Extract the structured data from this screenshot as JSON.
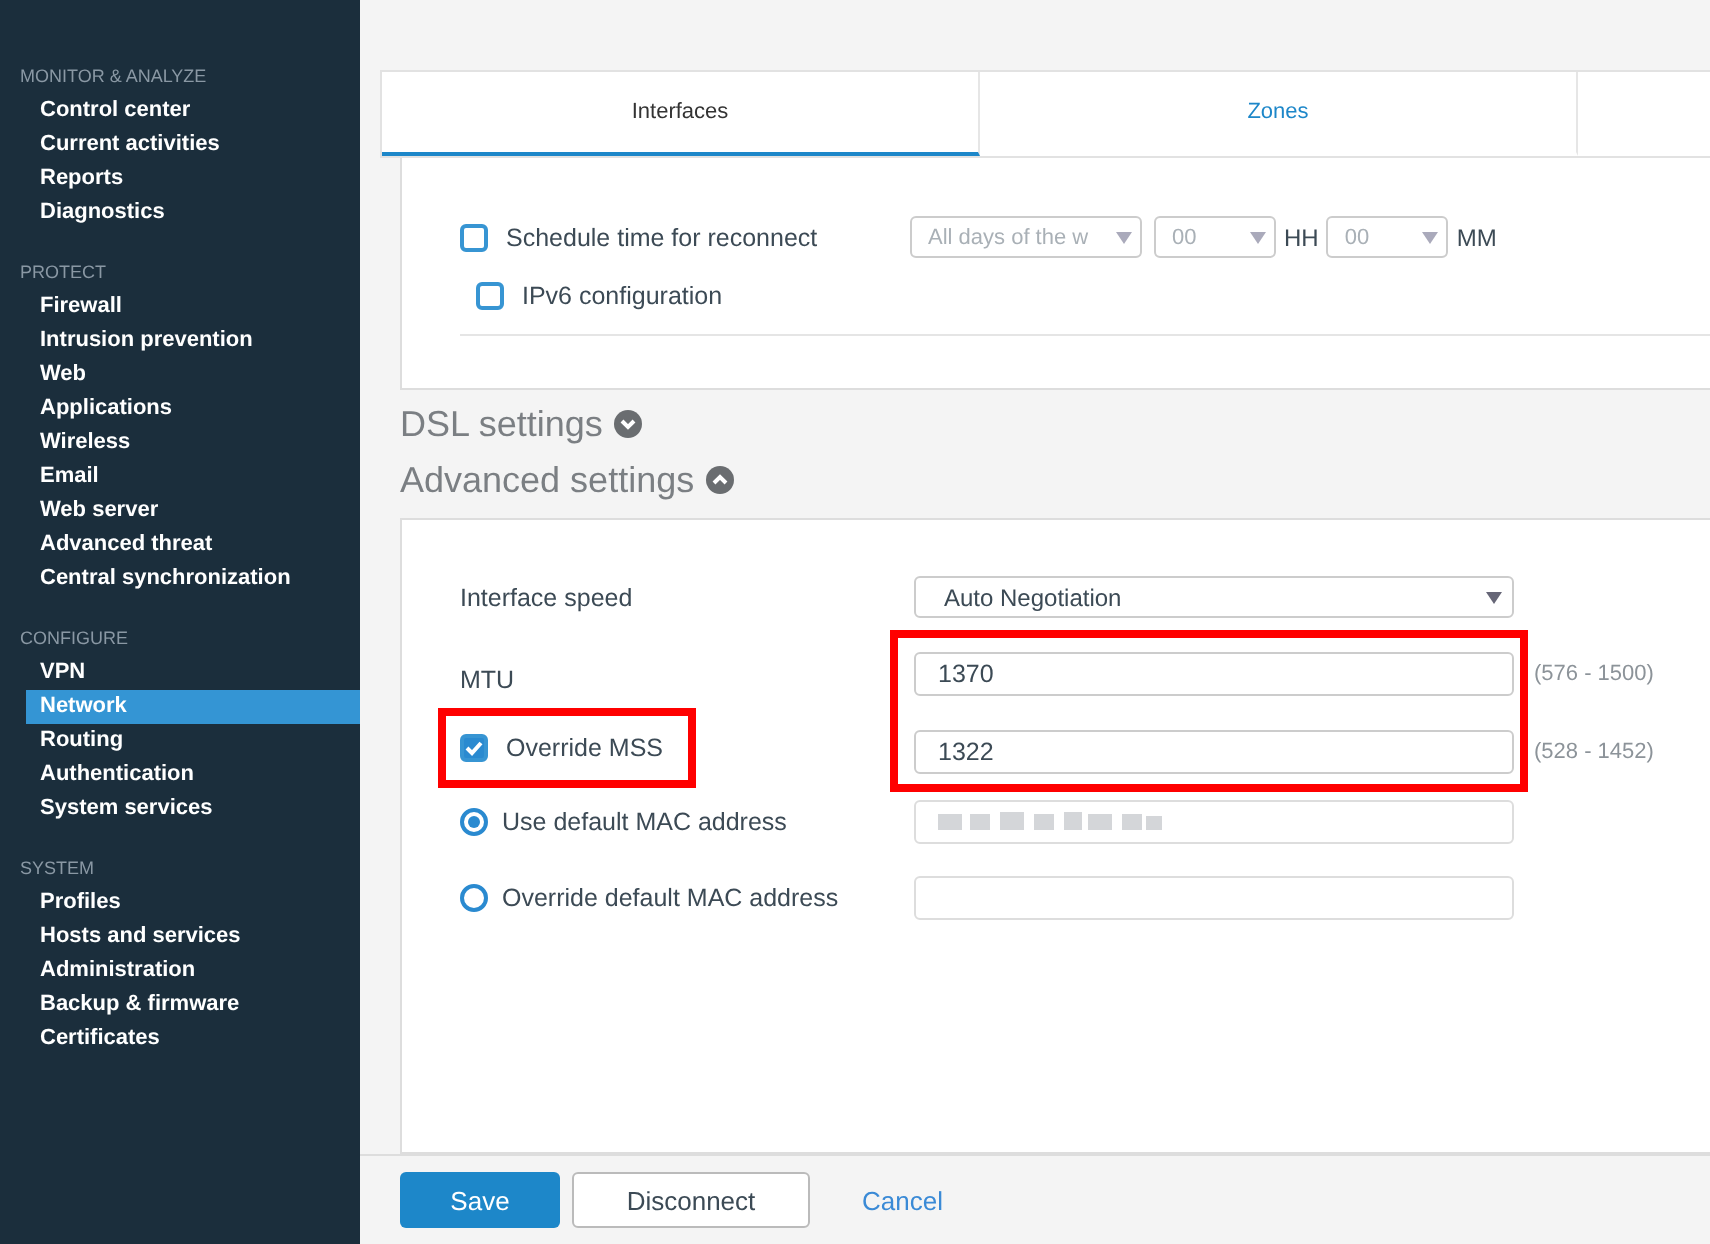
{
  "sidebar": {
    "sections": [
      {
        "title": "MONITOR & ANALYZE",
        "items": [
          {
            "label": "Control center",
            "selected": false
          },
          {
            "label": "Current activities",
            "selected": false
          },
          {
            "label": "Reports",
            "selected": false
          },
          {
            "label": "Diagnostics",
            "selected": false
          }
        ]
      },
      {
        "title": "PROTECT",
        "items": [
          {
            "label": "Firewall",
            "selected": false
          },
          {
            "label": "Intrusion prevention",
            "selected": false
          },
          {
            "label": "Web",
            "selected": false
          },
          {
            "label": "Applications",
            "selected": false
          },
          {
            "label": "Wireless",
            "selected": false
          },
          {
            "label": "Email",
            "selected": false
          },
          {
            "label": "Web server",
            "selected": false
          },
          {
            "label": "Advanced threat",
            "selected": false
          },
          {
            "label": "Central synchronization",
            "selected": false
          }
        ]
      },
      {
        "title": "CONFIGURE",
        "items": [
          {
            "label": "VPN",
            "selected": false
          },
          {
            "label": "Network",
            "selected": true
          },
          {
            "label": "Routing",
            "selected": false
          },
          {
            "label": "Authentication",
            "selected": false
          },
          {
            "label": "System services",
            "selected": false
          }
        ]
      },
      {
        "title": "SYSTEM",
        "items": [
          {
            "label": "Profiles",
            "selected": false
          },
          {
            "label": "Hosts and services",
            "selected": false
          },
          {
            "label": "Administration",
            "selected": false
          },
          {
            "label": "Backup & firmware",
            "selected": false
          },
          {
            "label": "Certificates",
            "selected": false
          }
        ]
      }
    ]
  },
  "tabs": [
    {
      "label": "Interfaces",
      "selected": true
    },
    {
      "label": "Zones",
      "selected": false
    }
  ],
  "connection_panel": {
    "schedule_reconnect": {
      "label": "Schedule time for reconnect",
      "checked": false,
      "day_select": {
        "value": "All days of the w",
        "disabled": true
      },
      "hour_select": {
        "value": "00",
        "disabled": true
      },
      "hour_unit": "HH",
      "minute_select": {
        "value": "00",
        "disabled": true
      },
      "minute_unit": "MM"
    },
    "ipv6": {
      "label": "IPv6 configuration",
      "checked": false
    }
  },
  "sections": [
    {
      "title": "DSL settings",
      "expanded": false
    },
    {
      "title": "Advanced settings",
      "expanded": true
    }
  ],
  "advanced": {
    "interface_speed": {
      "label": "Interface speed",
      "value": "Auto Negotiation"
    },
    "inputs_highlighted": true,
    "mtu": {
      "label": "MTU",
      "value": "1370",
      "range": "(576 - 1500)"
    },
    "override_mss": {
      "label": "Override MSS",
      "checked": true,
      "highlighted": true,
      "value": "1322",
      "range": "(528 - 1452)"
    },
    "mac_options": [
      {
        "label": "Use default MAC address",
        "selected": true,
        "redacted": true
      },
      {
        "label": "Override default MAC address",
        "selected": false,
        "redacted": false
      }
    ]
  },
  "footer": {
    "save": "Save",
    "disconnect": "Disconnect",
    "cancel": "Cancel"
  }
}
